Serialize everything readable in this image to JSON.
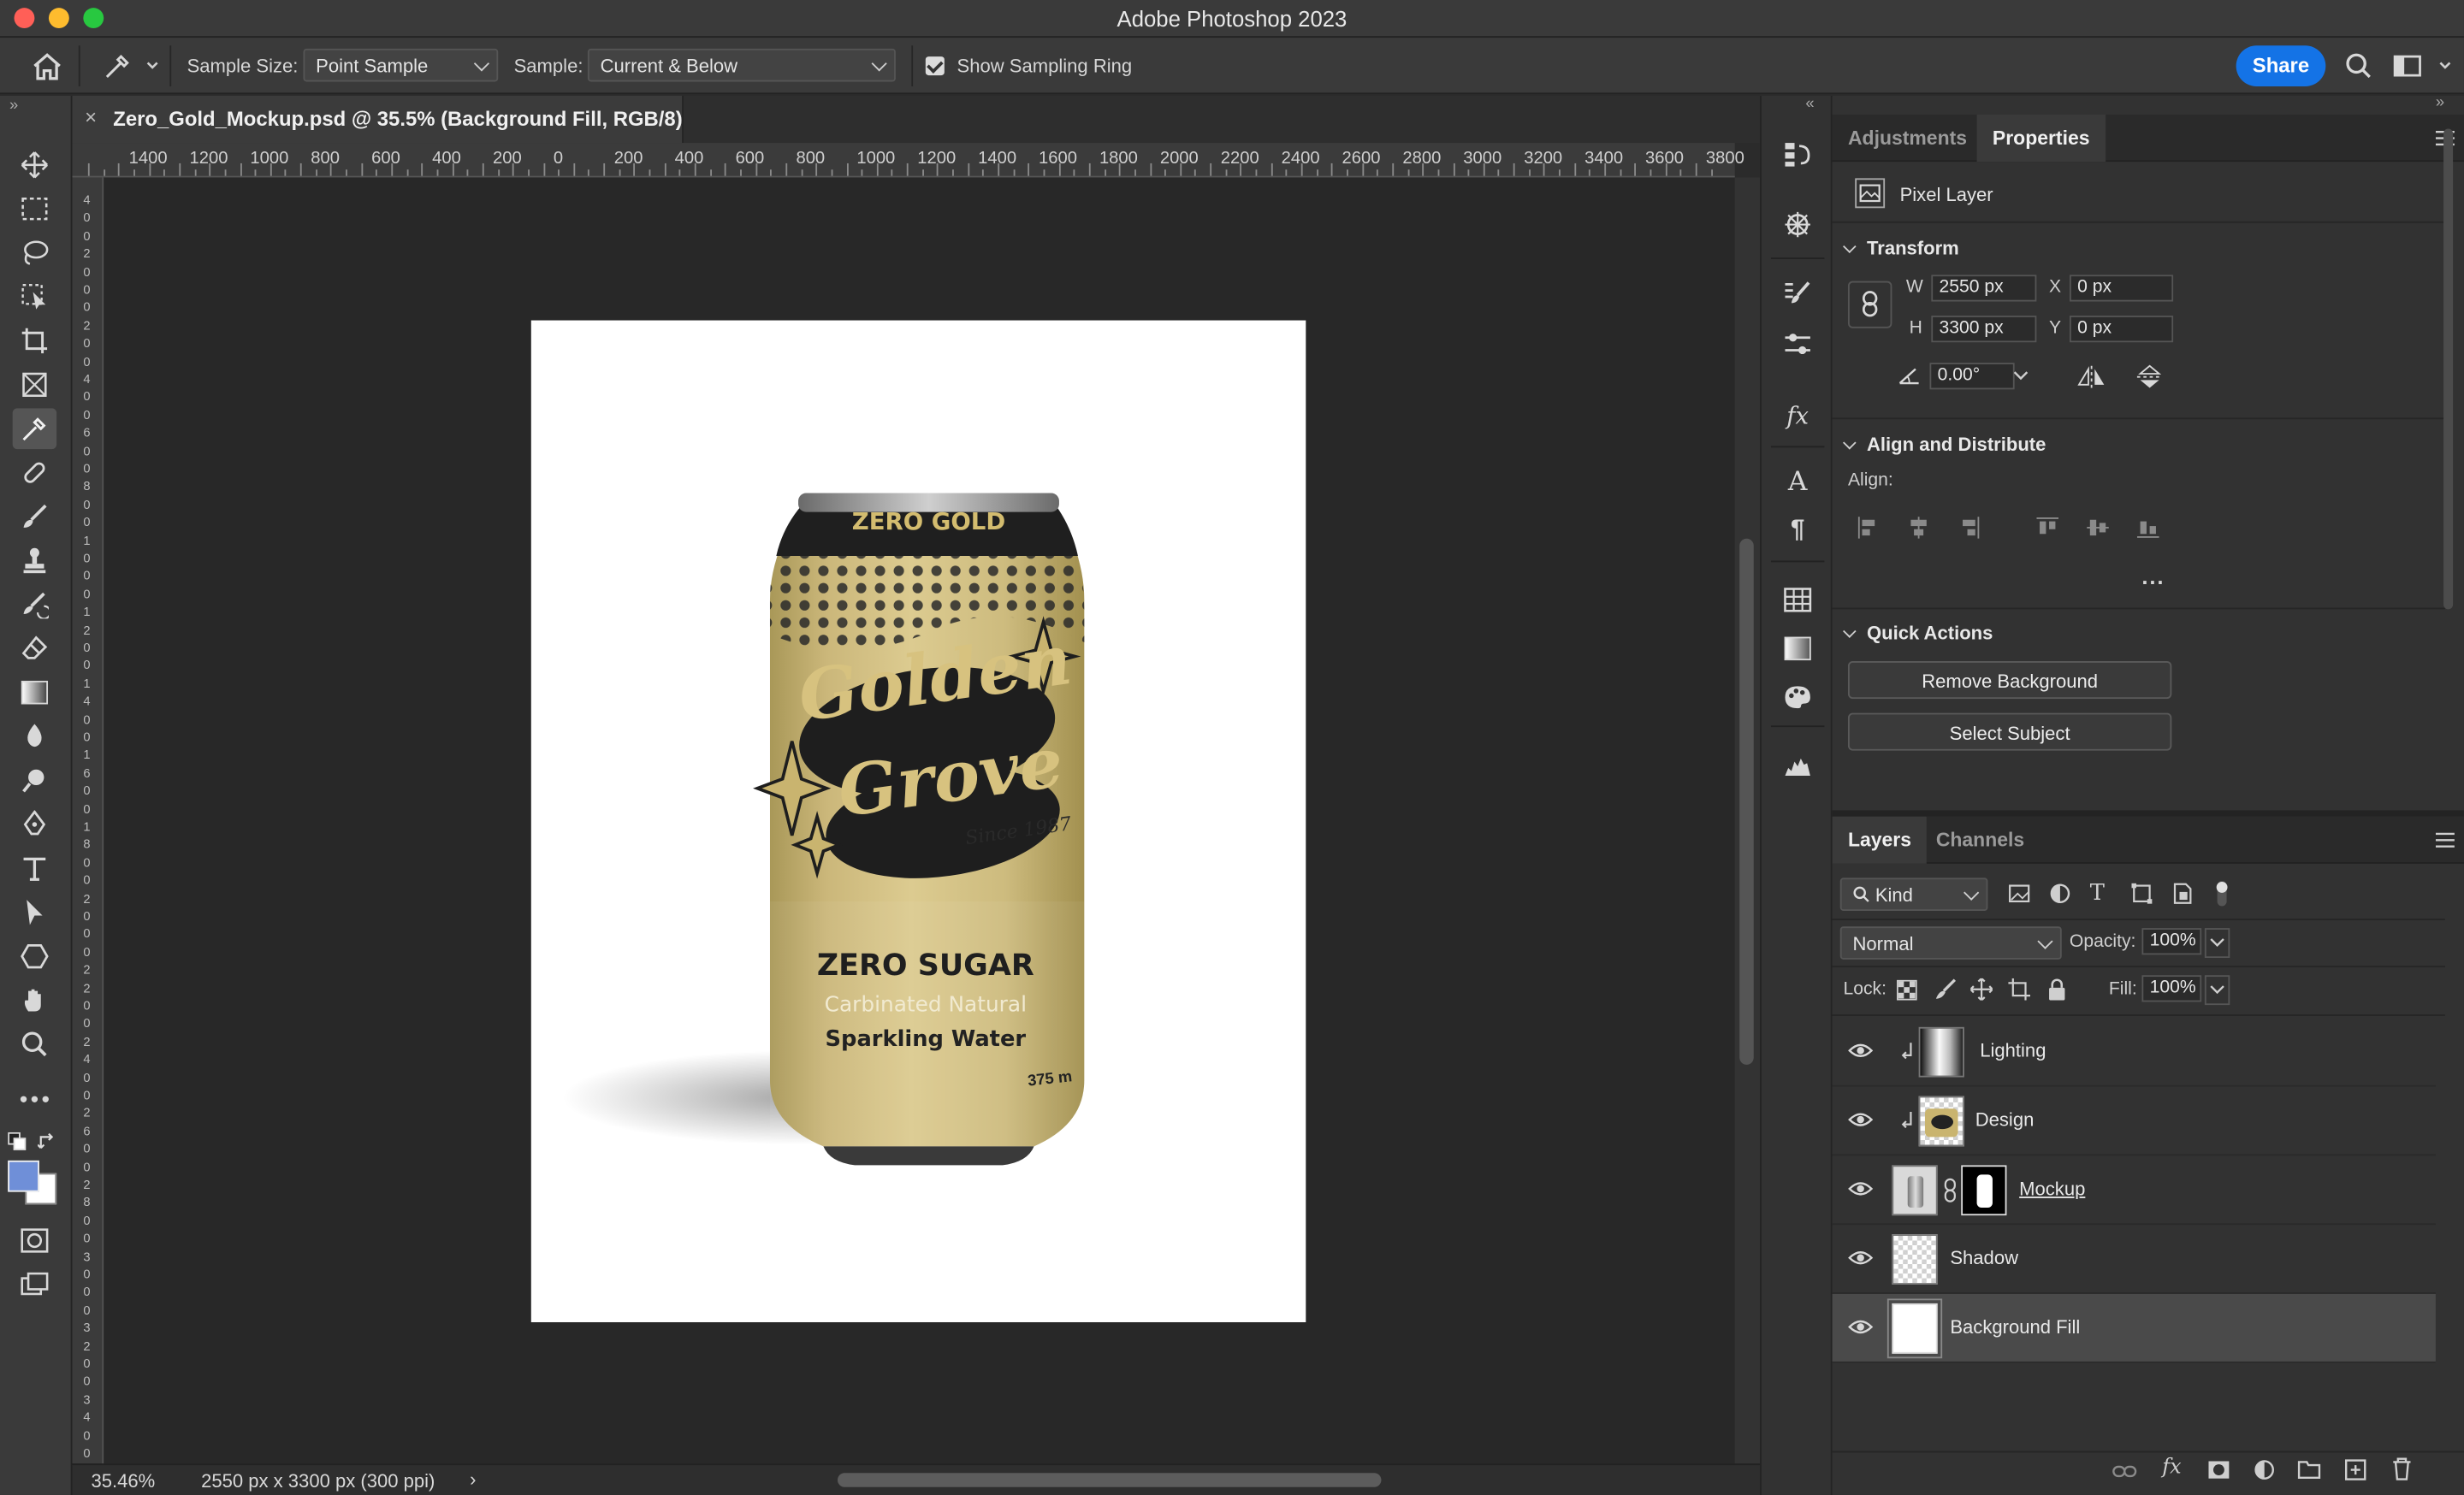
{
  "app": {
    "title": "Adobe Photoshop 2023"
  },
  "options_bar": {
    "sample_size_label": "Sample Size:",
    "sample_size_value": "Point Sample",
    "sample_label": "Sample:",
    "sample_value": "Current & Below",
    "show_sampling_ring_label": "Show Sampling Ring",
    "show_sampling_ring_checked": true,
    "share_label": "Share"
  },
  "document": {
    "tab_label": "Zero_Gold_Mockup.psd @ 35.5% (Background Fill, RGB/8)",
    "zoom": "35.46%",
    "doc_info": "2550 px x 3300 px (300 ppi)"
  },
  "ruler": {
    "top_ticks": [
      "1400",
      "1200",
      "1000",
      "800",
      "600",
      "400",
      "200",
      "0",
      "200",
      "400",
      "600",
      "800",
      "1000",
      "1200",
      "1400",
      "1600",
      "1800",
      "2000",
      "2200",
      "2400",
      "2600",
      "2800",
      "3000",
      "3200",
      "3400",
      "3600",
      "3800"
    ],
    "left_ticks": [
      "4",
      "0",
      "0",
      "2",
      "0",
      "0",
      "0",
      "2",
      "0",
      "0",
      "4",
      "0",
      "0",
      "6",
      "0",
      "0",
      "8",
      "0",
      "0",
      "1",
      "0",
      "0",
      "0",
      "1",
      "2",
      "0",
      "0",
      "1",
      "4",
      "0",
      "0",
      "1",
      "6",
      "0",
      "0",
      "1",
      "8",
      "0",
      "0",
      "2",
      "0",
      "0",
      "0",
      "2",
      "2",
      "0",
      "0",
      "2",
      "4",
      "0",
      "0",
      "2",
      "6",
      "0",
      "0",
      "2",
      "8",
      "0",
      "0",
      "3",
      "0",
      "0",
      "0",
      "3",
      "2",
      "0",
      "0",
      "3",
      "4",
      "0",
      "0"
    ]
  },
  "can": {
    "top_text": "ZERO GOLD",
    "brand_line1": "Golden",
    "brand_line2": "Grove",
    "since": "Since 1987",
    "headline": "ZERO SUGAR",
    "sub1": "Carbinated Natural",
    "sub2": "Sparkling Water",
    "volume": "375 m"
  },
  "panels": {
    "top_tabs": [
      {
        "label": "Adjustments",
        "active": false
      },
      {
        "label": "Properties",
        "active": true
      }
    ],
    "layer_type": "Pixel Layer",
    "transform": {
      "title": "Transform",
      "w_label": "W",
      "w": "2550 px",
      "h_label": "H",
      "h": "3300 px",
      "x_label": "X",
      "x": "0 px",
      "y_label": "Y",
      "y": "0 px",
      "angle": "0.00°"
    },
    "align": {
      "title": "Align and Distribute",
      "label": "Align:",
      "more": "..."
    },
    "quick_actions": {
      "title": "Quick Actions",
      "remove_background": "Remove Background",
      "select_subject": "Select Subject"
    }
  },
  "layers_panel": {
    "tabs": [
      {
        "label": "Layers",
        "active": true
      },
      {
        "label": "Channels",
        "active": false
      }
    ],
    "filter_kind": "Kind",
    "blend_mode": "Normal",
    "opacity_label": "Opacity:",
    "opacity": "100%",
    "lock_label": "Lock:",
    "fill_label": "Fill:",
    "fill": "100%",
    "layers": [
      {
        "name": "Lighting",
        "visible": true,
        "clipped": true,
        "selected": false
      },
      {
        "name": "Design",
        "visible": true,
        "clipped": true,
        "selected": false
      },
      {
        "name": "Mockup",
        "visible": true,
        "clipped": false,
        "selected": false,
        "has_mask": true
      },
      {
        "name": "Shadow",
        "visible": true,
        "clipped": false,
        "selected": false
      },
      {
        "name": "Background Fill",
        "visible": true,
        "clipped": false,
        "selected": true
      }
    ]
  },
  "colors": {
    "foreground": "#6f8fd8",
    "background": "#ffffff",
    "accent": "#1473e6",
    "can_gold": "#cfba7a"
  }
}
